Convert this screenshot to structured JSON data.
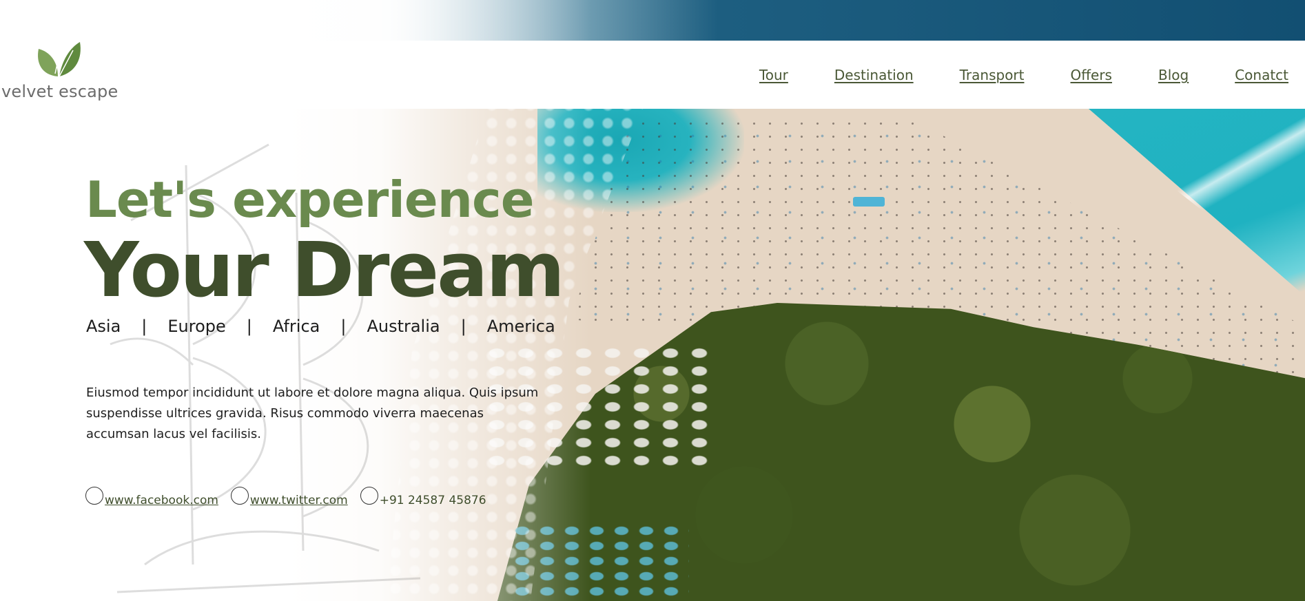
{
  "brand": {
    "name": "velvet escape",
    "logo_icon": "leaf-logo-icon"
  },
  "nav": {
    "items": [
      {
        "label": "Tour"
      },
      {
        "label": "Destination"
      },
      {
        "label": "Transport"
      },
      {
        "label": "Offers"
      },
      {
        "label": "Blog"
      },
      {
        "label": "Conatct"
      }
    ]
  },
  "hero": {
    "line1": "Let's experience",
    "line2": "Your Dream",
    "regions": [
      "Asia",
      "Europe",
      "Africa",
      "Australia",
      "America"
    ],
    "separator": "|",
    "description": "Eiusmod tempor incididunt ut labore et dolore magna aliqua. Quis ipsum suspendisse ultrices gravida. Risus commodo viverra maecenas accumsan lacus vel facilisis."
  },
  "contacts": {
    "facebook": " www.facebook.com",
    "twitter": " www.twitter.com",
    "phone": "+91 24587 45876"
  },
  "colors": {
    "accent_green": "#6a8a4e",
    "dark_green": "#3f4e2c",
    "ocean": "#1fb2c1",
    "forest": "#3e541d",
    "sand": "#e6d6c4"
  }
}
